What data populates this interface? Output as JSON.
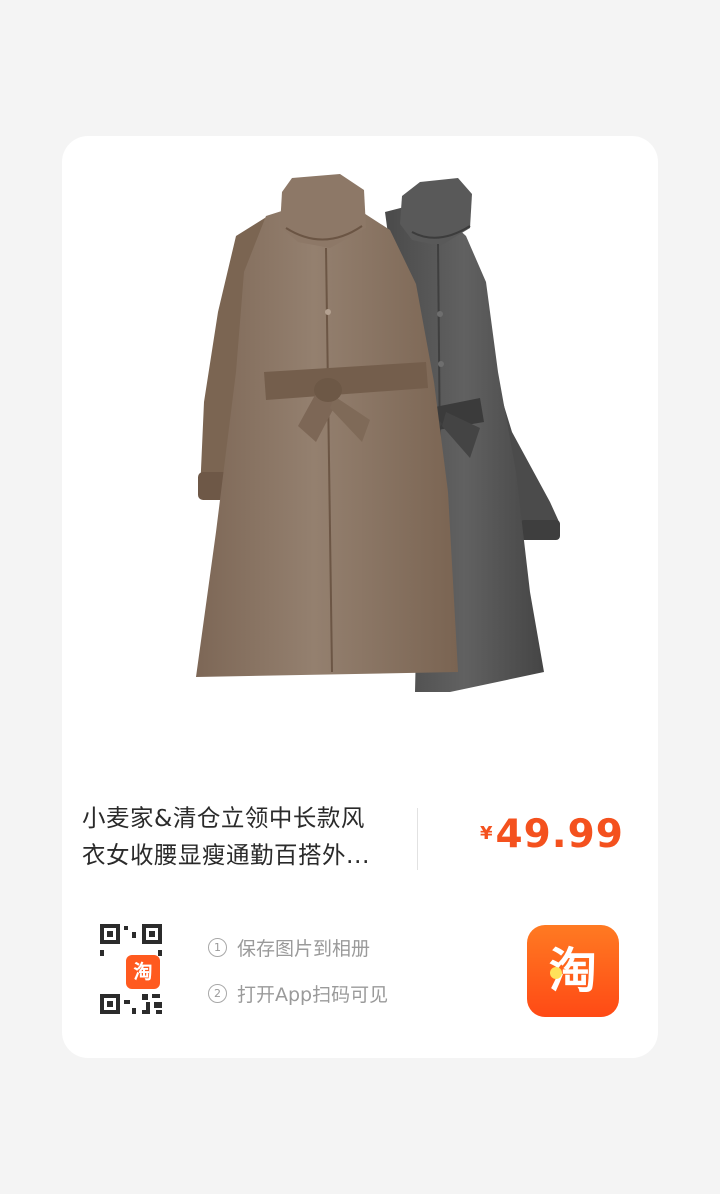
{
  "product": {
    "image_alt": "",
    "title_line1": "小麦家&清仓立领中长款风",
    "title_line2": "衣女收腰显瘦通勤百搭外...",
    "price_currency": "¥",
    "price_amount": "49.99"
  },
  "share": {
    "qr_badge_glyph": "淘",
    "step1_num": "①",
    "step1_label": "保存图片到相册",
    "step2_num": "②",
    "step2_label": "打开App扫码可见"
  },
  "app": {
    "logo_glyph": "淘"
  },
  "colors": {
    "page_bg": "#f4f4f4",
    "card_bg": "#ffffff",
    "price": "#f4511e",
    "brand_orange": "#ff5a1f",
    "coat_brown": "#8a7361",
    "coat_gray": "#535353"
  },
  "icons": {
    "qr": "qr-code-icon",
    "logo": "taobao-logo-icon"
  }
}
